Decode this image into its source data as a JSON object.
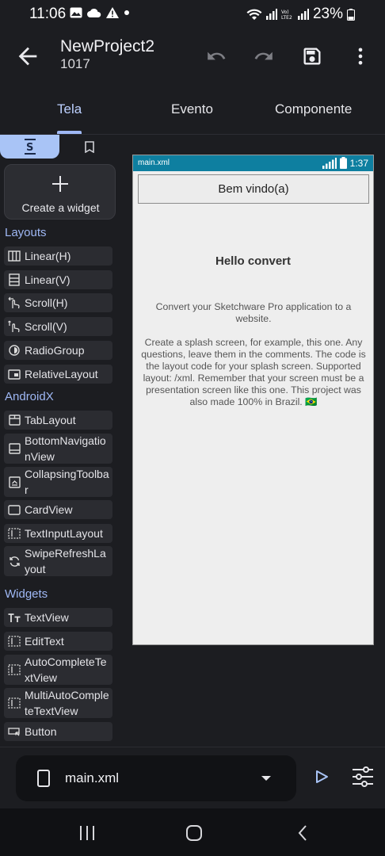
{
  "status_bar": {
    "time": "11:06",
    "battery": "23%"
  },
  "app_bar": {
    "title": "NewProject2",
    "subtitle": "1017"
  },
  "tabs": [
    {
      "label": "Tela"
    },
    {
      "label": "Evento"
    },
    {
      "label": "Componente"
    }
  ],
  "palette": {
    "create_widget": "Create a widget",
    "sections": {
      "layouts": "Layouts",
      "androidx": "AndroidX",
      "widgets": "Widgets"
    },
    "layouts": [
      {
        "label": "Linear(H)",
        "icon": "linear-h-icon"
      },
      {
        "label": "Linear(V)",
        "icon": "linear-v-icon"
      },
      {
        "label": "Scroll(H)",
        "icon": "scroll-h-icon"
      },
      {
        "label": "Scroll(V)",
        "icon": "scroll-v-icon"
      },
      {
        "label": "RadioGroup",
        "icon": "radio-icon"
      },
      {
        "label": "RelativeLayout",
        "icon": "relative-icon"
      }
    ],
    "androidx": [
      {
        "label": "TabLayout",
        "icon": "tab-icon"
      },
      {
        "label": "BottomNavigationView",
        "icon": "bottom-nav-icon"
      },
      {
        "label": "CollapsingToolbar",
        "icon": "collapsing-icon"
      },
      {
        "label": "CardView",
        "icon": "card-icon"
      },
      {
        "label": "TextInputLayout",
        "icon": "text-input-icon"
      },
      {
        "label": "SwipeRefreshLayout",
        "icon": "swipe-refresh-icon"
      }
    ],
    "widgets": [
      {
        "label": "TextView",
        "icon": "text-icon"
      },
      {
        "label": "EditText",
        "icon": "edit-text-icon"
      },
      {
        "label": "AutoCompleteTextView",
        "icon": "autocomplete-icon"
      },
      {
        "label": "MultiAutoCompleteTextView",
        "icon": "multi-autocomplete-icon"
      },
      {
        "label": "Button",
        "icon": "button-icon"
      }
    ]
  },
  "preview": {
    "file": "main.xml",
    "time": "1:37",
    "button_label": "Bem vindo(a)",
    "title": "Hello convert",
    "text_1": "Convert your Sketchware Pro application to a website.",
    "text_2": "Create a splash screen, for example, this one. Any questions, leave them in the comments. The code is the layout code for your splash screen. Supported layout: /xml. Remember that your screen must be a presentation screen like this one. This project was also made 100% in Brazil. 🇧🇷"
  },
  "bottom_bar": {
    "file": "main.xml"
  }
}
